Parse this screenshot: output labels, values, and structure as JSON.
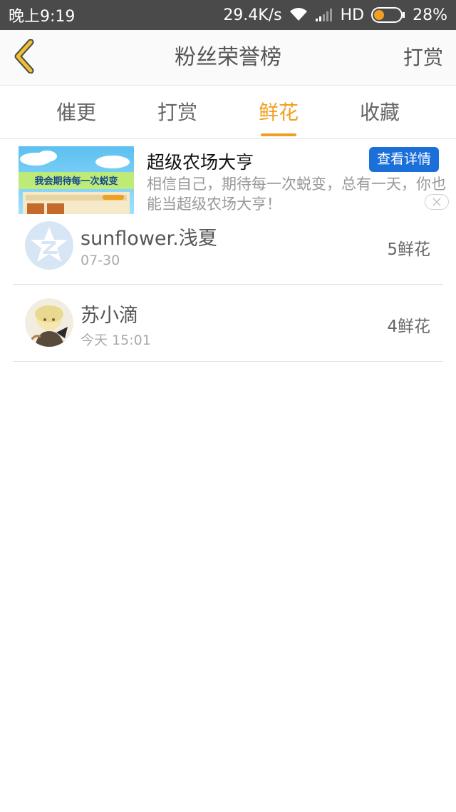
{
  "status_bar": {
    "time": "晚上9:19",
    "speed": "29.4K/s",
    "network": "HD",
    "battery": "28%",
    "battery_color": "#f0a020"
  },
  "nav": {
    "title": "粉丝荣誉榜",
    "action_label": "打赏",
    "back_icon": "chevron-left-icon",
    "accent_color": "#f0a020"
  },
  "tabs": [
    {
      "label": "催更",
      "active": false
    },
    {
      "label": "打赏",
      "active": false
    },
    {
      "label": "鲜花",
      "active": true
    },
    {
      "label": "收藏",
      "active": false
    }
  ],
  "ad": {
    "image_caption": "我会期待每一次蜕变",
    "title": "超级农场大亨",
    "description": "相信自己，期待每一次蜕变，总有一天，你也能当超级农场大亨！",
    "button_label": "查看详情",
    "button_color": "#1a6fd8",
    "close_icon": "close-icon"
  },
  "list": [
    {
      "name": "sunflower.浅夏",
      "time": "07-30",
      "count": "5鲜花",
      "avatar": "qzone-default-avatar"
    },
    {
      "name": "苏小滴",
      "time": "今天 15:01",
      "count": "4鲜花",
      "avatar": "anime-character-avatar"
    }
  ]
}
